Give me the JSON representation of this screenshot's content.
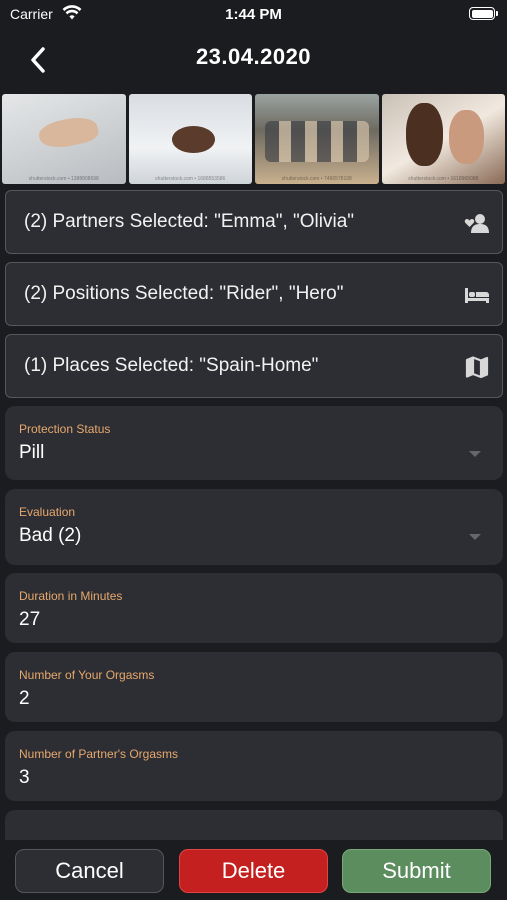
{
  "status_bar": {
    "carrier": "Carrier",
    "time": "1:44 PM"
  },
  "nav": {
    "title": "23.04.2020"
  },
  "photos": [
    {
      "watermark": "shutterstock.com • 1388808698"
    },
    {
      "watermark": "shutterstock.com • 1688553586"
    },
    {
      "watermark": "shutterstock.com • 7496578108"
    },
    {
      "watermark": "shutterstock.com • 1618965088"
    }
  ],
  "selections": {
    "partners": {
      "label": "(2)  Partners Selected: \"Emma\", \"Olivia\"",
      "icon": "user-heart-icon"
    },
    "positions": {
      "label": "(2)  Positions Selected: \"Rider\", \"Hero\"",
      "icon": "bed-icon"
    },
    "places": {
      "label": "(1)  Places Selected: \"Spain-Home\"",
      "icon": "map-icon"
    }
  },
  "fields": {
    "protection": {
      "label": "Protection Status",
      "value": "Pill"
    },
    "evaluation": {
      "label": "Evaluation",
      "value": "Bad (2)"
    },
    "duration": {
      "label": "Duration in Minutes",
      "value": "27"
    },
    "your_orgasms": {
      "label": "Number of Your Orgasms",
      "value": "2"
    },
    "partner_orgasms": {
      "label": "Number of Partner's Orgasms",
      "value": "3"
    }
  },
  "buttons": {
    "cancel": "Cancel",
    "delete": "Delete",
    "submit": "Submit"
  },
  "colors": {
    "background": "#1b1c1f",
    "card": "#2d2e33",
    "label_accent": "#e6a86e",
    "delete": "#c4201f",
    "submit": "#5c8d5f"
  }
}
